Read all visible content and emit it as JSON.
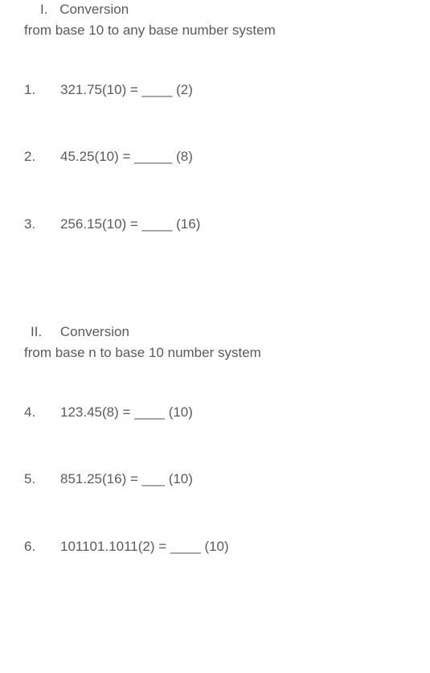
{
  "section1": {
    "roman": "I.",
    "title": "Conversion",
    "subtitle": "from base 10 to any base number system",
    "problems": [
      {
        "num": "1.",
        "text": "321.75(10) = ____ (2)"
      },
      {
        "num": "2.",
        "text": "45.25(10) = _____ (8)"
      },
      {
        "num": "3.",
        "text": "256.15(10) = ____ (16)"
      }
    ]
  },
  "section2": {
    "roman": "II.",
    "title": "Conversion",
    "subtitle": "from base n to base  10 number system",
    "problems": [
      {
        "num": "4.",
        "text": "123.45(8) = ____ (10)"
      },
      {
        "num": "5.",
        "text": "851.25(16) = ___ (10)"
      },
      {
        "num": "6.",
        "text": "101101.1011(2) = ____ (10)"
      }
    ]
  }
}
